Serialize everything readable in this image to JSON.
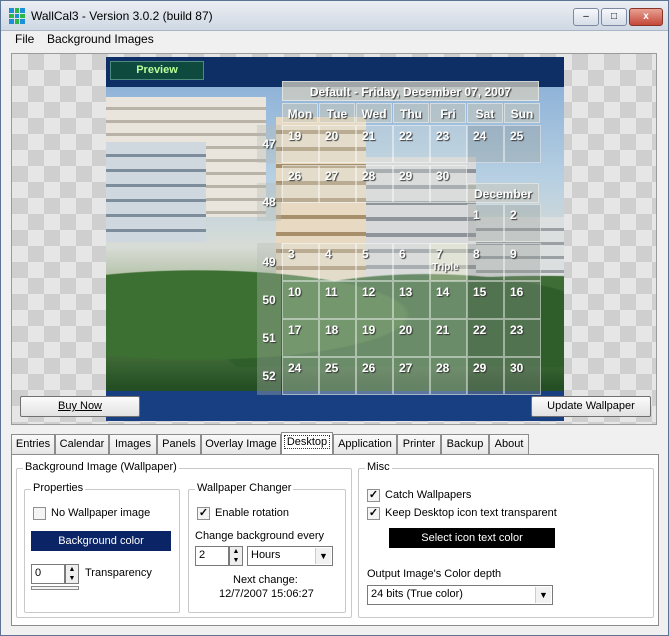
{
  "window": {
    "title": "WallCal3 - Version 3.0.2 (build 87)",
    "controls": {
      "minimize": "–",
      "maximize": "□",
      "close": "x"
    }
  },
  "menu": [
    "File",
    "Background Images"
  ],
  "preview": {
    "label": "Preview",
    "calendar": {
      "title": "Default - Friday, December 07, 2007",
      "days": [
        "Mon",
        "Tue",
        "Wed",
        "Thu",
        "Fri",
        "Sat",
        "Sun"
      ],
      "weeks": [
        "47",
        "48",
        "49",
        "50",
        "51",
        "52"
      ],
      "row1": [
        "19",
        "20",
        "21",
        "22",
        "23",
        "24",
        "25"
      ],
      "row2": [
        "26",
        "27",
        "28",
        "29",
        "30"
      ],
      "month_label": "December",
      "row2b": [
        "1",
        "2"
      ],
      "row3": [
        "3",
        "4",
        "5",
        "6",
        "7",
        "8",
        "9"
      ],
      "row3_note": "Triple",
      "row4": [
        "10",
        "11",
        "12",
        "13",
        "14",
        "15",
        "16"
      ],
      "row5": [
        "17",
        "18",
        "19",
        "20",
        "21",
        "22",
        "23"
      ],
      "row6": [
        "24",
        "25",
        "26",
        "27",
        "28",
        "29",
        "30"
      ]
    },
    "buy_now": "Buy Now",
    "update_wallpaper": "Update Wallpaper"
  },
  "tabs": [
    "Entries",
    "Calendar",
    "Images",
    "Panels",
    "Overlay Image",
    "Desktop",
    "Application",
    "Printer",
    "Backup",
    "About"
  ],
  "active_tab": "Desktop",
  "desktop": {
    "bg_group": "Background Image (Wallpaper)",
    "properties_group": "Properties",
    "no_wallpaper": "No Wallpaper image",
    "background_color": "Background color",
    "transparency_value": "0",
    "transparency_label": "Transparency",
    "changer_group": "Wallpaper Changer",
    "enable_rotation": "Enable rotation",
    "change_every": "Change background every",
    "interval_value": "2",
    "interval_unit": "Hours",
    "next_change_label": "Next change:",
    "next_change_value": "12/7/2007 15:06:27",
    "misc_group": "Misc",
    "catch_wallpapers": "Catch Wallpapers",
    "keep_transparent": "Keep Desktop icon text transparent",
    "select_icon_color": "Select icon text color",
    "color_depth_label": "Output Image's Color depth",
    "color_depth_value": "24 bits (True color)",
    "check_mark": "✓"
  }
}
